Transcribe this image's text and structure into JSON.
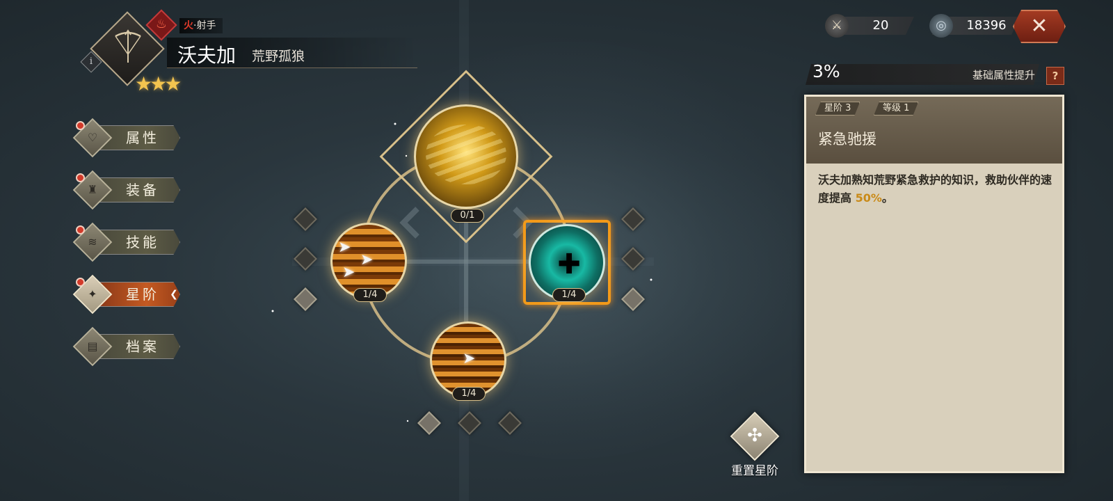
{
  "hero": {
    "element_label": "火",
    "separator": "·",
    "class_label": "射手",
    "name": "沃夫加",
    "title": "荒野孤狼",
    "stars": "★★★",
    "info_glyph": "i"
  },
  "menu": {
    "items": [
      {
        "label": "属性",
        "icon": "heart-icon",
        "glyph": "♡",
        "badge": true,
        "active": false
      },
      {
        "label": "装备",
        "icon": "armor-icon",
        "glyph": "♜",
        "badge": true,
        "active": false
      },
      {
        "label": "技能",
        "icon": "skill-icon",
        "glyph": "≋",
        "badge": true,
        "active": false
      },
      {
        "label": "星阶",
        "icon": "star-compass-icon",
        "glyph": "✦",
        "badge": true,
        "active": true
      },
      {
        "label": "档案",
        "icon": "profile-icon",
        "glyph": "▤",
        "badge": false,
        "active": false
      }
    ],
    "active_arrow": "❮"
  },
  "tree": {
    "top": {
      "count": "0/1",
      "icon": "golden-vortex-icon"
    },
    "left": {
      "count": "1/4",
      "icon": "arrows-icon"
    },
    "right": {
      "count": "1/4",
      "icon": "heal-cross-icon",
      "cross": "✚"
    },
    "bottom": {
      "count": "1/4",
      "icon": "spear-icon"
    },
    "arrow_glyph": "➤"
  },
  "resources": {
    "item1": {
      "value": "20",
      "icon": "bone-token-icon",
      "glyph": "⚔"
    },
    "item2": {
      "value": "18396",
      "icon": "silver-coin-icon",
      "glyph": "◎"
    },
    "close_glyph": "✕"
  },
  "bonus": {
    "value": "3%",
    "label": "基础属性提升",
    "help": "?"
  },
  "panel": {
    "tag_star": "星阶 3",
    "tag_level": "等级 1",
    "skill_name": "紧急驰援",
    "desc_prefix": "沃夫加熟知荒野紧急救护的知识，救助伙伴的速度提高 ",
    "desc_highlight": "50%",
    "desc_suffix": "。"
  },
  "reset": {
    "label": "重置星阶",
    "glyph": "✣"
  },
  "colors": {
    "accent_gold": "#f3c44f",
    "active_menu": "#c45a22",
    "highlight": "#c98a18",
    "close_red": "#a33a22"
  }
}
